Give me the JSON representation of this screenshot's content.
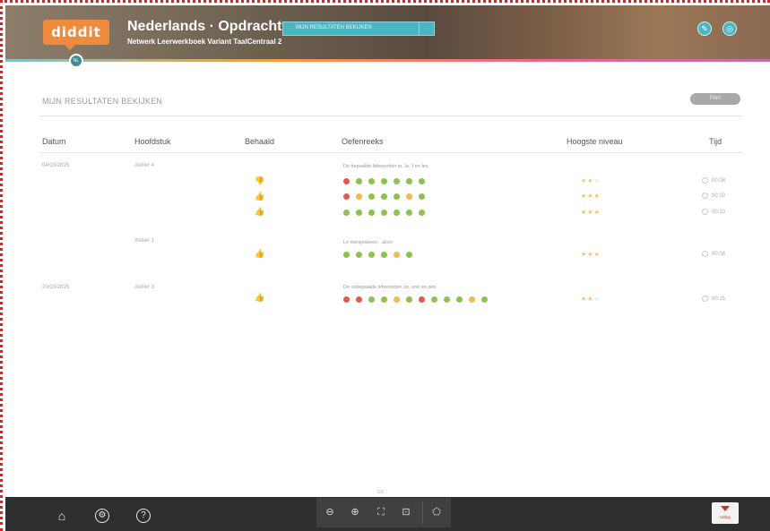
{
  "header": {
    "logo": "diddit",
    "title": "Nederlands · Opdrachten",
    "subtitle": "Netwerk Leerwerkboek Variant TaalCentraal 2",
    "selector_value": "MIJN RESULTATEN BEKIJKEN",
    "avatar_label": "NL",
    "edit_icon": "pencil-icon",
    "settings_icon": "circle-icon"
  },
  "page": {
    "section_title": "MIJN RESULTATEN BEKIJKEN",
    "print_label": "Print"
  },
  "table": {
    "headers": [
      "Datum",
      "Hoofdstuk",
      "Behaald",
      "Oefenreeks",
      "Hoogste niveau",
      "Tijd"
    ],
    "groups": [
      {
        "datum": "04/03/2015",
        "hoofdstuk": "Atelier 4",
        "reeks_title": "De bepaalde lidwoorden te, la, 't en les",
        "rows": [
          {
            "behaald": "neg",
            "dots": [
              "red",
              "green",
              "green",
              "green",
              "green",
              "green",
              "green"
            ],
            "stars": 2,
            "time": "00:08"
          },
          {
            "behaald": "pos",
            "dots": [
              "red",
              "orange",
              "green",
              "green",
              "green",
              "orange",
              "green"
            ],
            "stars": 3,
            "time": "00:10"
          },
          {
            "behaald": "pos",
            "dots": [
              "green",
              "green",
              "green",
              "green",
              "green",
              "green",
              "green"
            ],
            "stars": 3,
            "time": "00:10"
          }
        ]
      },
      {
        "datum": "",
        "hoofdstuk": "Atelier 1",
        "reeks_title": "Le meisjeskeen - alom",
        "rows": [
          {
            "behaald": "pos",
            "dots": [
              "green",
              "green",
              "green",
              "green",
              "orange",
              "green"
            ],
            "stars": 3,
            "time": "00:08"
          }
        ]
      },
      {
        "datum": "20/03/2015",
        "hoofdstuk": "Atelier 3",
        "reeks_title": "De onbepaalde lidwoorden un, une en des",
        "rows": [
          {
            "behaald": "pos",
            "dots": [
              "red",
              "red",
              "green",
              "green",
              "orange",
              "green",
              "red",
              "green",
              "green",
              "green",
              "orange",
              "green"
            ],
            "stars": 2,
            "time": "00:15"
          }
        ]
      }
    ]
  },
  "footer": {
    "zoom_value": "100",
    "logout_label": "Uitlog"
  },
  "colors": {
    "red": "#e8574c",
    "green": "#8dc24b",
    "orange": "#f6b94a",
    "thumb_up": "#7cae3c",
    "thumb_down": "#e04a3c"
  }
}
